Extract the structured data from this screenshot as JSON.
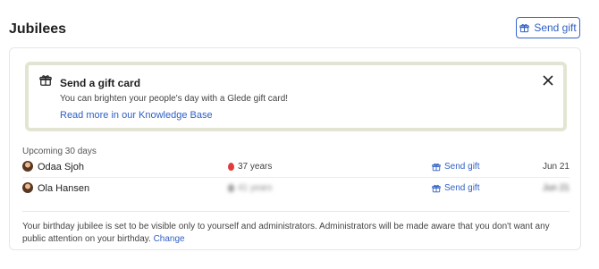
{
  "header": {
    "title": "Jubilees",
    "send_gift_label": "Send gift"
  },
  "banner": {
    "title": "Send a gift card",
    "text": "You can brighten your people's day with a Glede gift card!",
    "link": "Read more in our Knowledge Base",
    "icon": "gift-icon",
    "close_icon": "close-icon"
  },
  "section": {
    "label": "Upcoming 30 days"
  },
  "rows": [
    {
      "name": "Odaa Sjoh",
      "age": "37 years",
      "gift_label": "Send gift",
      "date": "Jun 21"
    },
    {
      "name": "Ola Hansen",
      "age": "41 years",
      "gift_label": "Send gift",
      "date": "Jun 21"
    }
  ],
  "footer": {
    "text": "Your birthday jubilee is set to be visible only to yourself and administrators. Administrators will be made aware that you don't want any public attention on your birthday.",
    "change_label": "Change"
  },
  "colors": {
    "accent": "#2f5fc4",
    "banner_border": "#e3e5d2",
    "balloon": "#e23b3b"
  }
}
